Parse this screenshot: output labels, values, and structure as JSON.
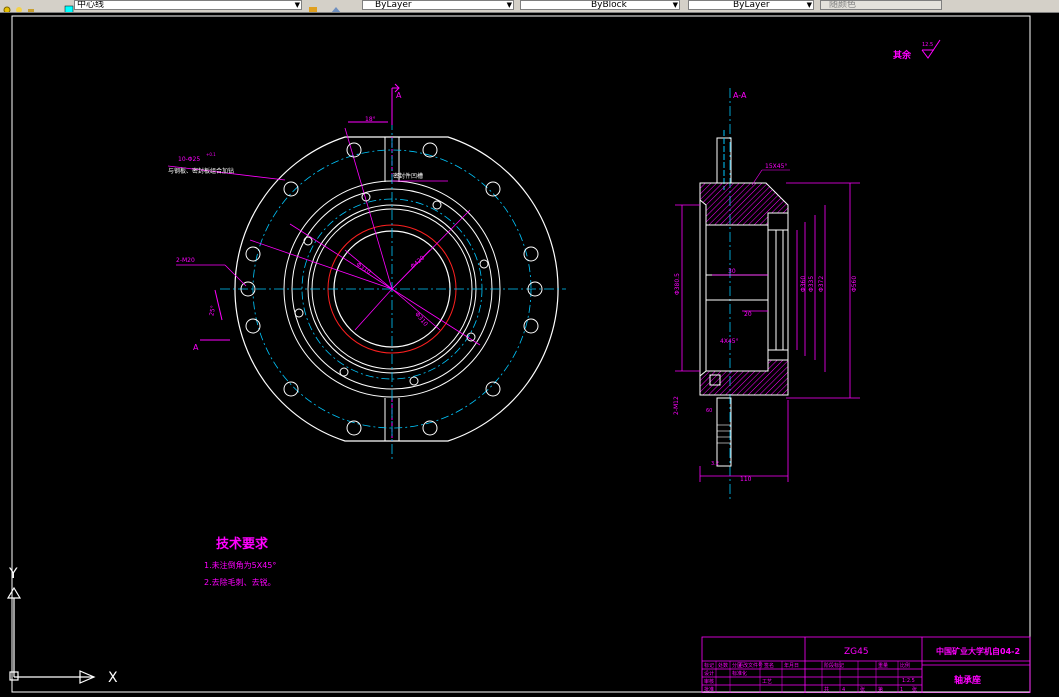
{
  "toolbar": {
    "layer_value": "中心线",
    "color_value": "ByLayer",
    "linetype_value": "ByBlock",
    "lineweight_value": "ByLayer",
    "plotstyle_value": "随颜色"
  },
  "drawing": {
    "roughness_note": "其余",
    "roughness_value": "12.5",
    "section_mark": "A",
    "section_title": "A-A",
    "hole_callout": "10-Φ25",
    "hole_callout_sup": "+0.1",
    "hole_note": "与钢板、密封板组合加钻",
    "tap_callout": "2-M20",
    "angle_18": "18°",
    "angle_25": "25°",
    "seal_note": "密封件凹槽",
    "dia_inner": "Φ310",
    "dia_pitch": "Φ420",
    "chamfer_top": "15X45°",
    "chamfer_bot": "4X45°",
    "dim_bore": "Φ360",
    "dim_310": "Φ310",
    "dim_335": "Φ335",
    "dim_372": "Φ372",
    "dim_outer": "Φ560",
    "dim_left": "Φ380.5",
    "dim_depth": "110",
    "dim_20": "20",
    "dim_30": "30",
    "dim_60": "60",
    "dim_94": "94",
    "dim_140": "140",
    "dim_m": "2-M12",
    "roughness_small": "3.2"
  },
  "tech": {
    "title": "技术要求",
    "items": [
      "1.未注倒角为5X45°",
      "2.去除毛刺、去锐。"
    ]
  },
  "title_block": {
    "material": "ZG45",
    "school": "中国矿业大学机自04-2",
    "part_name": "轴承座",
    "scale": "1:2.5",
    "headers": [
      "标记",
      "处数",
      "分区",
      "更改文件号",
      "签名",
      "年月日"
    ],
    "labels": [
      "阶段标记",
      "重量",
      "比例"
    ],
    "row_labels": [
      "设计",
      "标准化",
      "审核",
      "工艺",
      "批准"
    ],
    "sheet_text": [
      "共",
      "张",
      "第",
      "张"
    ],
    "sheet_nums": [
      "4",
      "1"
    ]
  },
  "ucs": {
    "y_label": "Y",
    "x_label": "X"
  }
}
